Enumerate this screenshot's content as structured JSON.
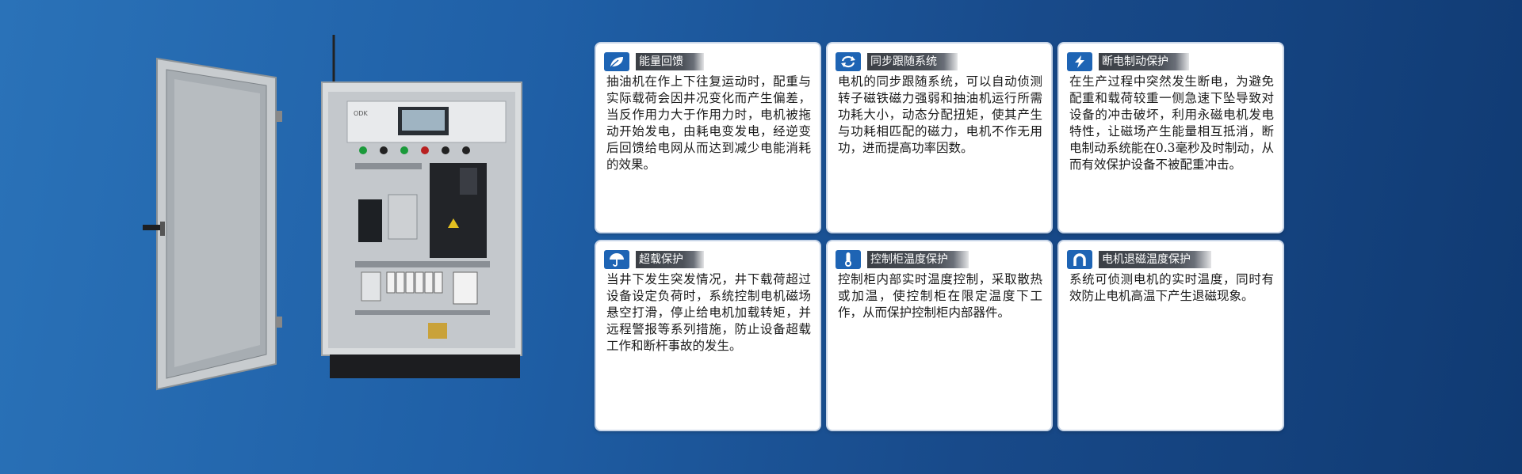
{
  "cards": [
    {
      "icon": "leaf-icon",
      "title": "能量回馈",
      "body": "抽油机在作上下往复运动时，配重与实际载荷会因井况变化而产生偏差，当反作用力大于作用力时，电机被拖动开始发电，由耗电变发电，经逆变后回馈给电网从而达到减少电能消耗的效果。"
    },
    {
      "icon": "sync-icon",
      "title": "同步跟随系统",
      "body": "电机的同步跟随系统，可以自动侦测转子磁铁磁力强弱和抽油机运行所需功耗大小，动态分配扭矩，使其产生与功耗相匹配的磁力，电机不作无用功，进而提高功率因数。"
    },
    {
      "icon": "lightning-icon",
      "title": "断电制动保护",
      "body": "在生产过程中突然发生断电，为避免配重和载荷较重一侧急速下坠导致对设备的冲击破坏，利用永磁电机发电特性，让磁场产生能量相互抵消，断电制动系统能在0.3毫秒及时制动，从而有效保护设备不被配重冲击。"
    },
    {
      "icon": "umbrella-icon",
      "title": "超载保护",
      "body": "当井下发生突发情况，井下载荷超过设备设定负荷时，系统控制电机磁场悬空打滑，停止给电机加载转矩，并远程警报等系列措施，防止设备超载工作和断杆事故的发生。"
    },
    {
      "icon": "thermometer-icon",
      "title": "控制柜温度保护",
      "body": "控制柜内部实时温度控制，采取散热或加温，使控制柜在限定温度下工作，从而保护控制柜内部器件。"
    },
    {
      "icon": "magnet-icon",
      "title": "电机退磁温度保护",
      "body": "系统可侦测电机的实时温度，同时有效防止电机高温下产生退磁现象。"
    }
  ],
  "cabinet": {
    "icon": "control-cabinet-image"
  },
  "colors": {
    "accent": "#1e64b4",
    "title_bar": "#3b3f45",
    "background": "#1f5fa6"
  }
}
